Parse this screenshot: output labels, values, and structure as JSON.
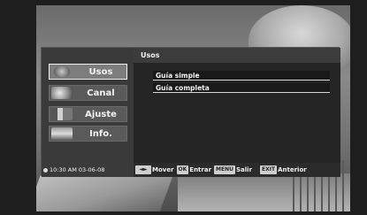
{
  "menu": {
    "items": [
      {
        "label": "Usos",
        "icon": "globe-icon",
        "active": true
      },
      {
        "label": "Canal",
        "icon": "satellite-dish-icon",
        "active": false
      },
      {
        "label": "Ajuste",
        "icon": "tools-icon",
        "active": false
      },
      {
        "label": "Info.",
        "icon": "info-book-icon",
        "active": false
      }
    ],
    "clock": "10:30 AM 03-06-08"
  },
  "panel": {
    "title": "Usos",
    "options": [
      "Guía simple",
      "Guía completa"
    ]
  },
  "footer": {
    "arrows_key": "◄►",
    "mover_label": "Mover",
    "ok_key": "OK",
    "entrar_label": "Entrar",
    "menu_key": "MENU",
    "salir_label": "Salir",
    "exit_key": "EXIT",
    "anterior_label": "Anterior"
  },
  "colors": {
    "osd_background": "#262626",
    "active_item_border": "#f0f0f0",
    "option_highlight": "#191919"
  }
}
